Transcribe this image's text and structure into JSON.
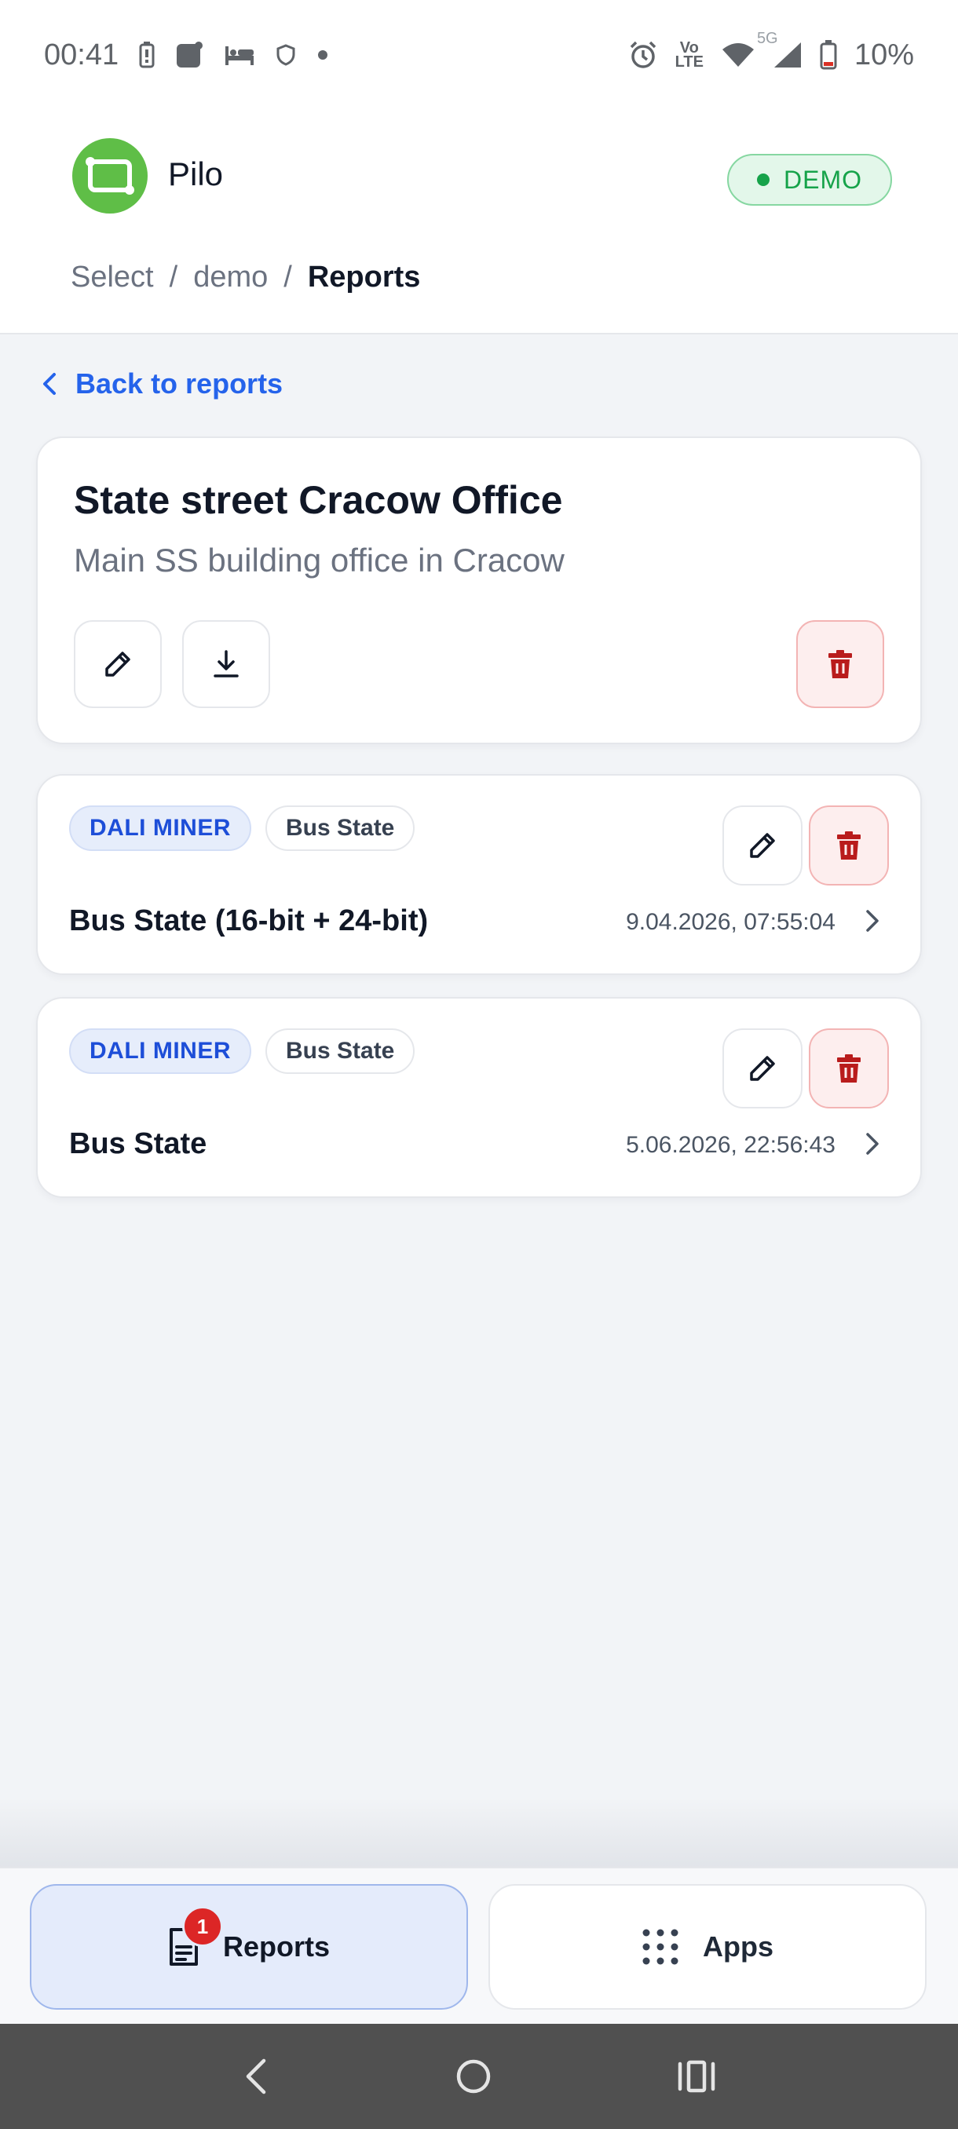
{
  "status_bar": {
    "time": "00:41",
    "battery_percent": "10%",
    "network_label_top": "Vo",
    "network_label_bottom": "LTE",
    "fiveg_label": "5G",
    "icons": [
      "battery-saver-icon",
      "app-notification-icon",
      "bed-icon",
      "shield-icon",
      "dot-icon",
      "alarm-icon",
      "volte-icon",
      "wifi-icon",
      "signal-icon",
      "battery-icon"
    ]
  },
  "header": {
    "app_name": "Pilo",
    "badge": "DEMO",
    "breadcrumb": {
      "items": [
        "Select",
        "demo"
      ],
      "separator": "/",
      "current": "Reports"
    }
  },
  "back_link": "Back to reports",
  "office": {
    "title": "State street Cracow Office",
    "subtitle": "Main SS building office in Cracow"
  },
  "reports": [
    {
      "tag_primary": "DALI MINER",
      "tag_secondary": "Bus State",
      "title": "Bus State (16-bit + 24-bit)",
      "date": "9.04.2026, 07:55:04"
    },
    {
      "tag_primary": "DALI MINER",
      "tag_secondary": "Bus State",
      "title": "Bus State",
      "date": "5.06.2026, 22:56:43"
    }
  ],
  "bottom_nav": {
    "reports_label": "Reports",
    "reports_badge": "1",
    "apps_label": "Apps"
  },
  "colors": {
    "accent_blue": "#2563eb",
    "brand_green": "#5fbe47",
    "danger_red": "#b91c1c",
    "demo_green": "#16a34a"
  }
}
